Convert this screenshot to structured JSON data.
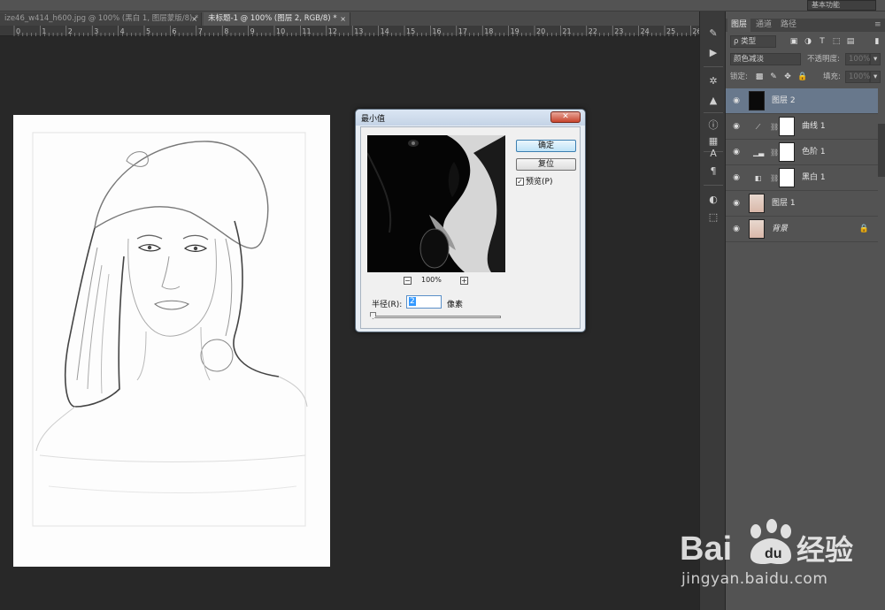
{
  "workspace_switcher": "基本功能",
  "tabs": [
    {
      "label": "ize46_w414_h600.jpg @ 100% (黑白 1, 图层蒙版/8) *",
      "close": "×"
    },
    {
      "label": "未标题-1 @ 100% (图层 2, RGB/8) *",
      "close": "×"
    }
  ],
  "ruler_labels": [
    "0",
    "1",
    "2",
    "3",
    "4",
    "5",
    "6",
    "7",
    "8",
    "9",
    "10",
    "11",
    "12",
    "13",
    "14",
    "15",
    "16",
    "17",
    "18",
    "19",
    "20",
    "21",
    "22",
    "23",
    "24",
    "25",
    "26"
  ],
  "dialog": {
    "title": "最小值",
    "close": "✕",
    "ok": "确定",
    "reset": "复位",
    "preview_label": "预览(P)",
    "preview_checked": "✓",
    "zoom_out": "−",
    "zoom_in": "+",
    "zoom_level": "100%",
    "radius_label": "半径(R):",
    "radius_value": "2",
    "radius_unit": "像素"
  },
  "layers_panel": {
    "tabs": [
      "图层",
      "通道",
      "路径"
    ],
    "filter_kind": "ρ 类型",
    "blend_mode": "颜色减淡",
    "opacity_label": "不透明度:",
    "opacity_value": "100%",
    "lock_label": "锁定:",
    "fill_label": "填充:",
    "fill_value": "100%",
    "layers": [
      {
        "name": "图层 2",
        "selected": true
      },
      {
        "name": "曲线 1",
        "selected": false
      },
      {
        "name": "色阶 1",
        "selected": false
      },
      {
        "name": "黑白 1",
        "selected": false
      },
      {
        "name": "图层 1",
        "selected": false
      },
      {
        "name": "背景",
        "selected": false
      }
    ]
  },
  "watermark": {
    "logo_text": "Bai",
    "logo_text2": "经验",
    "url": "jingyan.baidu.com"
  }
}
